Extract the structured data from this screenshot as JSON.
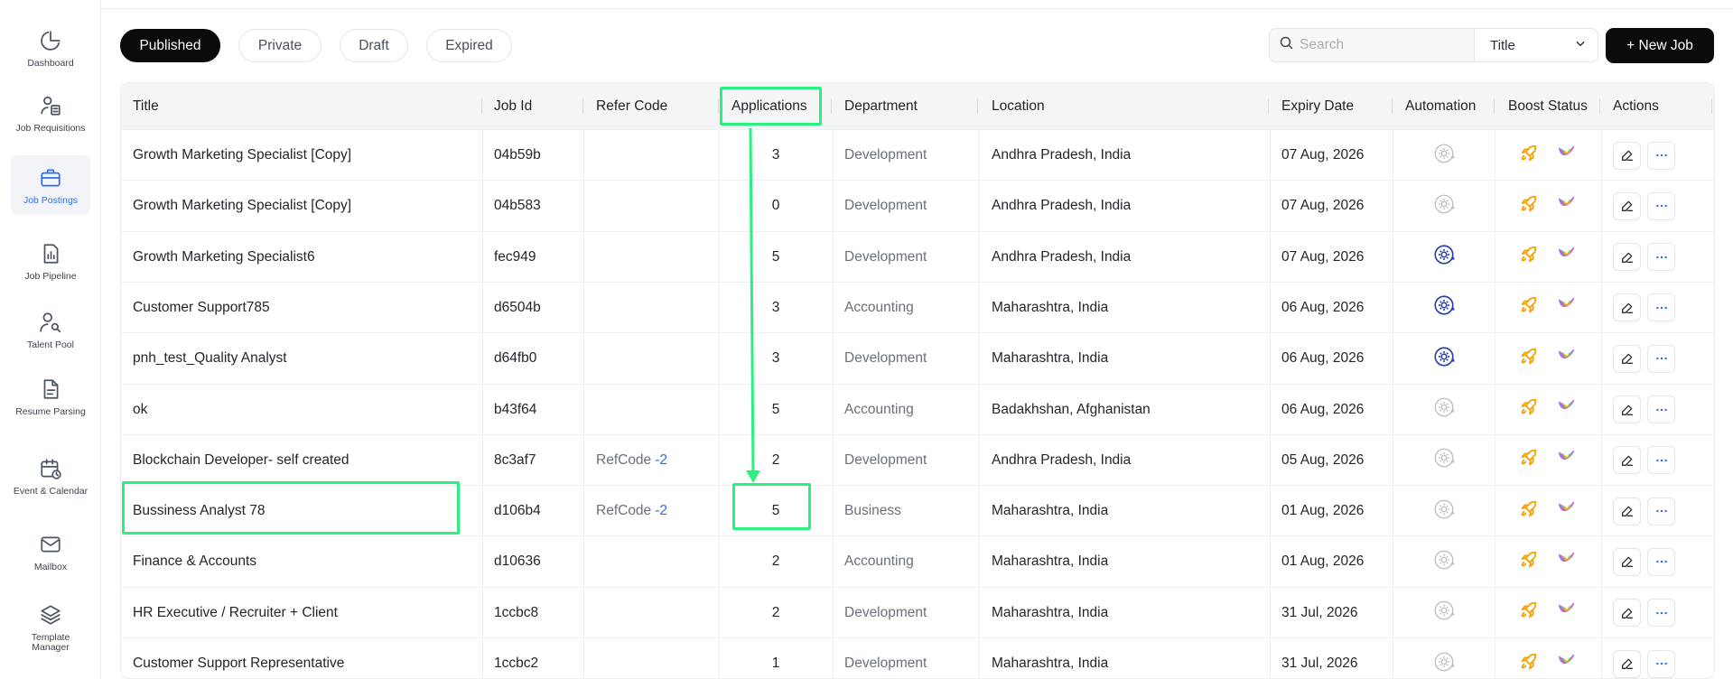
{
  "sidebar": {
    "items": [
      {
        "label": "Dashboard",
        "icon": "pie-chart-icon",
        "active": false
      },
      {
        "label": "Job Requisitions",
        "icon": "job-requisition-icon",
        "active": false
      },
      {
        "label": "Job Postings",
        "icon": "briefcase-icon",
        "active": true
      },
      {
        "label": "Job Pipeline",
        "icon": "pipeline-chart-icon",
        "active": false
      },
      {
        "label": "Talent Pool",
        "icon": "user-search-icon",
        "active": false
      },
      {
        "label": "Resume Parsing",
        "icon": "document-icon",
        "active": false
      },
      {
        "label": "Event & Calendar",
        "icon": "calendar-icon",
        "active": false
      },
      {
        "label": "Mailbox",
        "icon": "mail-icon",
        "active": false
      },
      {
        "label": "Template Manager",
        "icon": "layers-icon",
        "active": false
      }
    ]
  },
  "filters": {
    "tabs": [
      "Published",
      "Private",
      "Draft",
      "Expired"
    ],
    "active": "Published"
  },
  "search": {
    "placeholder": "Search",
    "value": ""
  },
  "search_by": {
    "selected": "Title"
  },
  "new_job_label": "+ New Job",
  "table": {
    "columns": [
      "Title",
      "Job Id",
      "Refer Code",
      "Applications",
      "Department",
      "Location",
      "Expiry Date",
      "Automation",
      "Boost Status",
      "Actions"
    ],
    "rows": [
      {
        "title": "Growth Marketing Specialist [Copy]",
        "job_id": "04b59b",
        "refer_code": "",
        "refer_num": "",
        "applications": "3",
        "department": "Development",
        "location": "Andhra Pradesh, India",
        "expiry": "07 Aug, 2026",
        "automation": "inactive"
      },
      {
        "title": "Growth Marketing Specialist [Copy]",
        "job_id": "04b583",
        "refer_code": "",
        "refer_num": "",
        "applications": "0",
        "department": "Development",
        "location": "Andhra Pradesh, India",
        "expiry": "07 Aug, 2026",
        "automation": "inactive"
      },
      {
        "title": "Growth Marketing Specialist6",
        "job_id": "fec949",
        "refer_code": "",
        "refer_num": "",
        "applications": "5",
        "department": "Development",
        "location": "Andhra Pradesh, India",
        "expiry": "07 Aug, 2026",
        "automation": "active"
      },
      {
        "title": "Customer Support785",
        "job_id": "d6504b",
        "refer_code": "",
        "refer_num": "",
        "applications": "3",
        "department": "Accounting",
        "location": "Maharashtra, India",
        "expiry": "06 Aug, 2026",
        "automation": "active"
      },
      {
        "title": "pnh_test_Quality Analyst",
        "job_id": "d64fb0",
        "refer_code": "",
        "refer_num": "",
        "applications": "3",
        "department": "Development",
        "location": "Maharashtra, India",
        "expiry": "06 Aug, 2026",
        "automation": "active"
      },
      {
        "title": "ok",
        "job_id": "b43f64",
        "refer_code": "",
        "refer_num": "",
        "applications": "5",
        "department": "Accounting",
        "location": "Badakhshan, Afghanistan",
        "expiry": "06 Aug, 2026",
        "automation": "inactive"
      },
      {
        "title": "Blockchain Developer- self created",
        "job_id": "8c3af7",
        "refer_code": "RefCode",
        "refer_num": "-2",
        "applications": "2",
        "department": "Development",
        "location": "Andhra Pradesh, India",
        "expiry": "05 Aug, 2026",
        "automation": "inactive"
      },
      {
        "title": "Bussiness Analyst 78",
        "job_id": "d106b4",
        "refer_code": "RefCode",
        "refer_num": "-2",
        "applications": "5",
        "department": "Business",
        "location": "Maharashtra, India",
        "expiry": "01 Aug, 2026",
        "automation": "inactive"
      },
      {
        "title": "Finance & Accounts",
        "job_id": "d10636",
        "refer_code": "",
        "refer_num": "",
        "applications": "2",
        "department": "Accounting",
        "location": "Maharashtra, India",
        "expiry": "01 Aug, 2026",
        "automation": "inactive"
      },
      {
        "title": "HR Executive / Recruiter + Client",
        "job_id": "1ccbc8",
        "refer_code": "",
        "refer_num": "",
        "applications": "2",
        "department": "Development",
        "location": "Maharashtra, India",
        "expiry": "31 Jul, 2026",
        "automation": "inactive"
      },
      {
        "title": "Customer Support Representative",
        "job_id": "1ccbc2",
        "refer_code": "",
        "refer_num": "",
        "applications": "1",
        "department": "Development",
        "location": "Maharashtra, India",
        "expiry": "31 Jul, 2026",
        "automation": "inactive"
      }
    ]
  },
  "colors": {
    "accent": "#2f6fed",
    "annotation": "#2cf07e",
    "boost_rocket": "#f5a300",
    "automation_active": "#2d3fb0",
    "automation_inactive": "#b9bdc4"
  }
}
